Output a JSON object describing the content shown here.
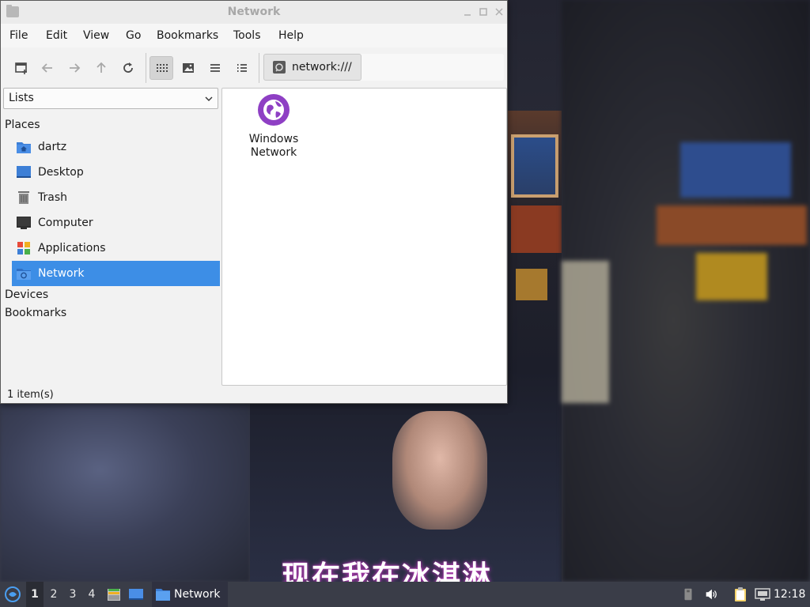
{
  "window": {
    "title": "Network"
  },
  "menubar": {
    "items": [
      "File",
      "Edit",
      "View",
      "Go",
      "Bookmarks",
      "Tools",
      "Help"
    ]
  },
  "toolbar": {
    "location": "network:///"
  },
  "sidebar": {
    "selector": "Lists",
    "places_heading": "Places",
    "items": [
      {
        "label": "dartz",
        "icon": "home-folder-icon"
      },
      {
        "label": "Desktop",
        "icon": "desktop-icon"
      },
      {
        "label": "Trash",
        "icon": "trash-icon"
      },
      {
        "label": "Computer",
        "icon": "computer-icon"
      },
      {
        "label": "Applications",
        "icon": "applications-icon"
      },
      {
        "label": "Network",
        "icon": "network-icon",
        "selected": true
      }
    ],
    "devices_heading": "Devices",
    "bookmarks_heading": "Bookmarks"
  },
  "content": {
    "items": [
      {
        "label": "Windows Network",
        "icon": "windows-network-icon"
      }
    ]
  },
  "statusbar": {
    "text": "1 item(s)"
  },
  "wallpaper": {
    "subtitle": "现在我在冰淇淋"
  },
  "taskbar": {
    "workspaces": [
      "1",
      "2",
      "3",
      "4"
    ],
    "active_workspace": "1",
    "task_label": "Network",
    "clock": "12:18"
  },
  "colors": {
    "selection": "#3d8ee6",
    "taskbar": "#3a3d48",
    "network_icon": "#8e3fc4"
  }
}
